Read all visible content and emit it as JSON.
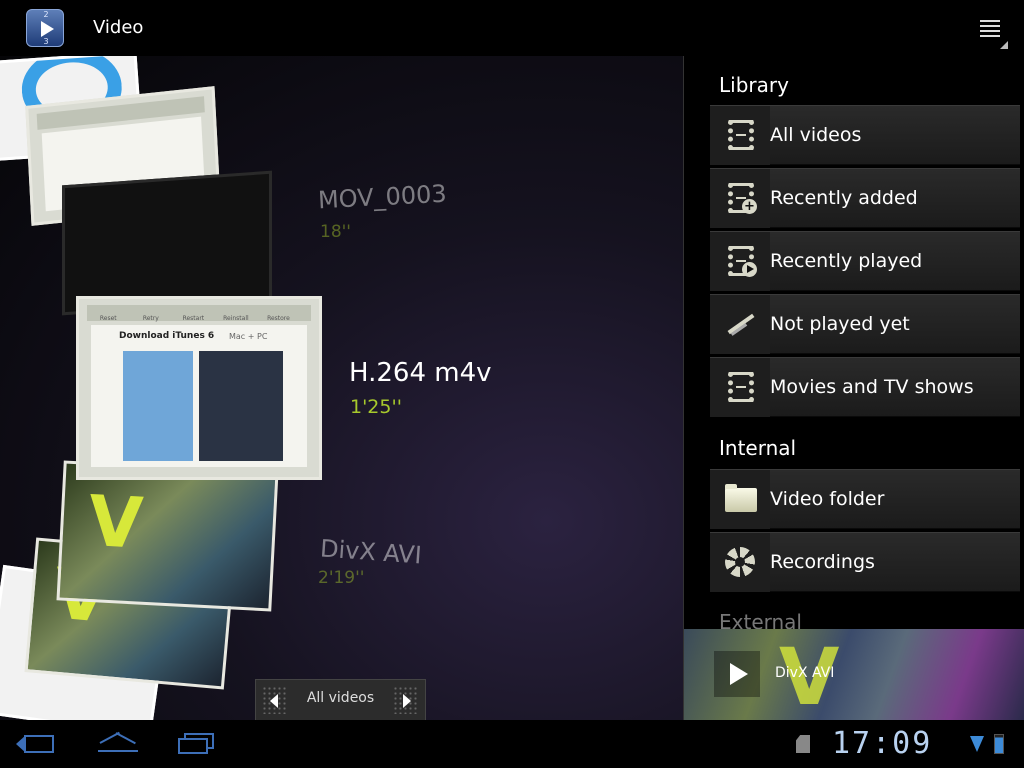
{
  "app": {
    "title": "Video",
    "icon": "video-app-icon",
    "icon_reels": [
      "2",
      "3"
    ]
  },
  "carousel": {
    "items": [
      {
        "title": "MOV_0003",
        "duration": "18''",
        "state": "above"
      },
      {
        "title": "H.264 m4v",
        "duration": "1'25''",
        "state": "selected"
      },
      {
        "title": "DivX AVI",
        "duration": "2'19''",
        "state": "below"
      }
    ],
    "web_thumb_tabs": [
      "Reset",
      "Retry",
      "Restart",
      "Reinstall",
      "Restore"
    ],
    "web_thumb_heading": "Download iTunes 6",
    "web_thumb_platform": "Mac + PC",
    "nav": {
      "label": "All videos",
      "prev_icon": "chevron-left-icon",
      "next_icon": "chevron-right-icon"
    }
  },
  "panel": {
    "sections": [
      {
        "title": "Library",
        "items": [
          {
            "label": "All videos",
            "icon": "film-icon"
          },
          {
            "label": "Recently added",
            "icon": "film-add-icon"
          },
          {
            "label": "Recently played",
            "icon": "film-play-icon"
          },
          {
            "label": "Not played yet",
            "icon": "not-played-icon"
          },
          {
            "label": "Movies and TV shows",
            "icon": "film-icon"
          }
        ]
      },
      {
        "title": "Internal",
        "items": [
          {
            "label": "Video folder",
            "icon": "folder-icon"
          },
          {
            "label": "Recordings",
            "icon": "aperture-icon"
          }
        ]
      },
      {
        "title": "External",
        "items": []
      }
    ]
  },
  "now_playing": {
    "title": "DivX AVI",
    "icon": "play-icon"
  },
  "system_bar": {
    "time": "17:09",
    "icons": [
      "back-icon",
      "home-icon",
      "recent-apps-icon",
      "sd-card-icon",
      "signal-icon",
      "battery-icon"
    ]
  },
  "colors": {
    "accent_duration": "#a7c92c",
    "system_blue": "#3d6fb8",
    "clock": "#b9d2f0"
  }
}
